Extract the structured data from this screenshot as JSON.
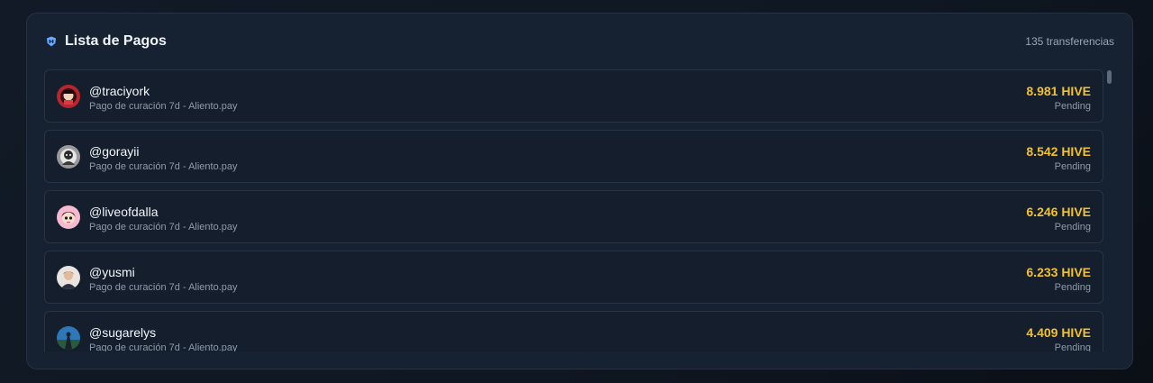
{
  "header": {
    "icon": "hive-shield-icon",
    "title": "Lista de Pagos",
    "count": "135 transferencias"
  },
  "colors": {
    "amount": "#f2c12e",
    "panel": "#162131",
    "item": "#141e2c"
  },
  "payments": [
    {
      "username": "@traciyork",
      "description": "Pago de curación 7d - Aliento.pay",
      "amount": "8.981 HIVE",
      "status": "Pending"
    },
    {
      "username": "@gorayii",
      "description": "Pago de curación 7d - Aliento.pay",
      "amount": "8.542 HIVE",
      "status": "Pending"
    },
    {
      "username": "@liveofdalla",
      "description": "Pago de curación 7d - Aliento.pay",
      "amount": "6.246 HIVE",
      "status": "Pending"
    },
    {
      "username": "@yusmi",
      "description": "Pago de curación 7d - Aliento.pay",
      "amount": "6.233 HIVE",
      "status": "Pending"
    },
    {
      "username": "@sugarelys",
      "description": "Pago de curación 7d - Aliento.pay",
      "amount": "4.409 HIVE",
      "status": "Pending"
    }
  ]
}
